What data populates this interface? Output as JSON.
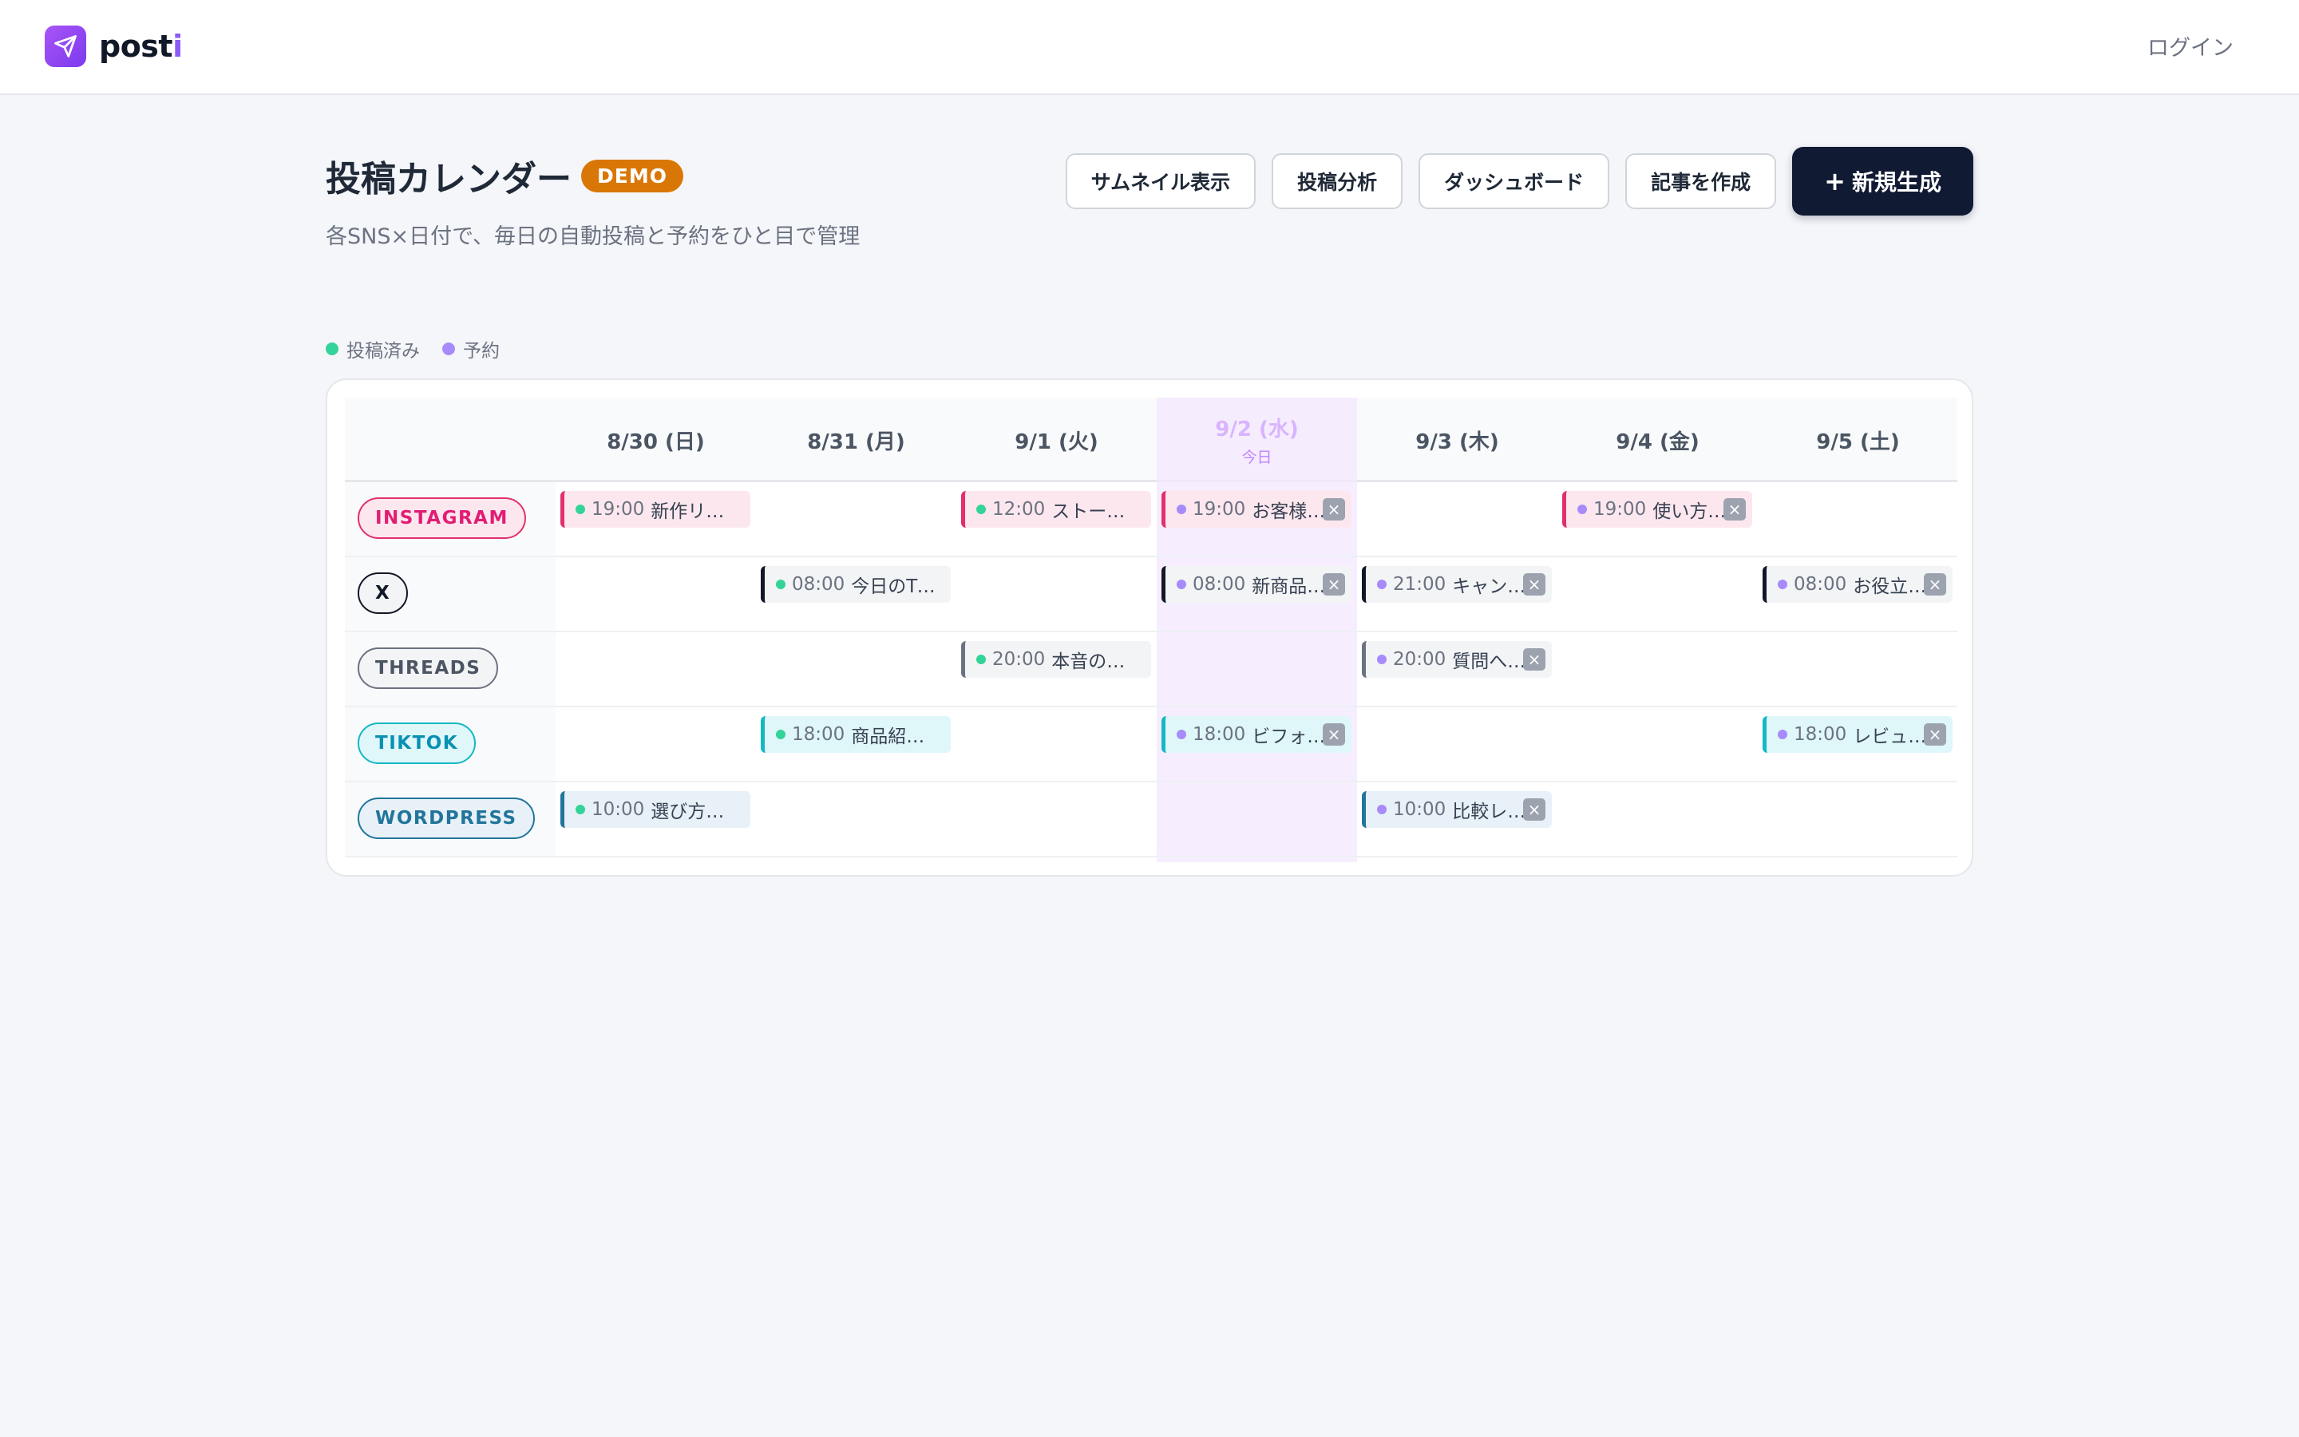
{
  "brand": {
    "name_main": "post",
    "name_accent": "i"
  },
  "nav": {
    "login_label": "ログイン"
  },
  "header": {
    "title": "投稿カレンダー",
    "badge": "DEMO",
    "subtitle": "各SNS×日付で、毎日の自動投稿と予約をひと目で管理"
  },
  "actions": {
    "thumbnail": "サムネイル表示",
    "analytics": "投稿分析",
    "dashboard": "ダッシュボード",
    "create_article": "記事を作成",
    "new_plus": "+",
    "new_label": "新規生成"
  },
  "legend": {
    "posted": {
      "label": "投稿済み",
      "color": "#34d399"
    },
    "scheduled": {
      "label": "予約",
      "color": "#a78bfa"
    }
  },
  "calendar": {
    "days": [
      {
        "label": "8/30 (日)"
      },
      {
        "label": "8/31 (月)"
      },
      {
        "label": "9/1 (火)"
      },
      {
        "label": "9/2 (水)",
        "today_label": "今日"
      },
      {
        "label": "9/3 (木)"
      },
      {
        "label": "9/4 (金)"
      },
      {
        "label": "9/5 (土)"
      }
    ],
    "platforms": [
      {
        "label": "INSTAGRAM",
        "color": "#e11d74",
        "bg": "#fde7ef",
        "border": "#e1306c"
      },
      {
        "label": "X",
        "color": "#111827",
        "bg": "#f3f4f6",
        "border": "#111827"
      },
      {
        "label": "THREADS",
        "color": "#4b5563",
        "bg": "#f3f4f6",
        "border": "#6b7280"
      },
      {
        "label": "TIKTOK",
        "color": "#0891b2",
        "bg": "#e0f7fa",
        "border": "#14b8c4"
      },
      {
        "label": "WORDPRESS",
        "color": "#21759b",
        "bg": "#e8f1f8",
        "border": "#21759b"
      }
    ],
    "posts": [
      {
        "row": 0,
        "day": 0,
        "time": "19:00",
        "title": "新作リー...",
        "status": "posted",
        "closable": false
      },
      {
        "row": 0,
        "day": 2,
        "time": "12:00",
        "title": "ストーリ...",
        "status": "posted",
        "closable": false
      },
      {
        "row": 0,
        "day": 3,
        "time": "19:00",
        "title": "お客様の...",
        "status": "scheduled",
        "closable": true
      },
      {
        "row": 0,
        "day": 5,
        "time": "19:00",
        "title": "使い方を...",
        "status": "scheduled",
        "closable": true
      },
      {
        "row": 1,
        "day": 1,
        "time": "08:00",
        "title": "今日のTips",
        "status": "posted",
        "closable": false
      },
      {
        "row": 1,
        "day": 3,
        "time": "08:00",
        "title": "新商品ス...",
        "status": "scheduled",
        "closable": true
      },
      {
        "row": 1,
        "day": 4,
        "time": "21:00",
        "title": "キャンペ...",
        "status": "scheduled",
        "closable": true
      },
      {
        "row": 1,
        "day": 6,
        "time": "08:00",
        "title": "お役立ち...",
        "status": "scheduled",
        "closable": true
      },
      {
        "row": 2,
        "day": 2,
        "time": "20:00",
        "title": "本音の投稿",
        "status": "posted",
        "closable": false
      },
      {
        "row": 2,
        "day": 4,
        "time": "20:00",
        "title": "質問への...",
        "status": "scheduled",
        "closable": true
      },
      {
        "row": 3,
        "day": 1,
        "time": "18:00",
        "title": "商品紹介...",
        "status": "posted",
        "closable": false
      },
      {
        "row": 3,
        "day": 3,
        "time": "18:00",
        "title": "ビフォー...",
        "status": "scheduled",
        "closable": true
      },
      {
        "row": 3,
        "day": 6,
        "time": "18:00",
        "title": "レビュー...",
        "status": "scheduled",
        "closable": true
      },
      {
        "row": 4,
        "day": 0,
        "time": "10:00",
        "title": "選び方ガ...",
        "status": "posted",
        "closable": false
      },
      {
        "row": 4,
        "day": 4,
        "time": "10:00",
        "title": "比較レビ...",
        "status": "scheduled",
        "closable": true
      }
    ],
    "close_glyph": "×",
    "today_index": 3
  }
}
